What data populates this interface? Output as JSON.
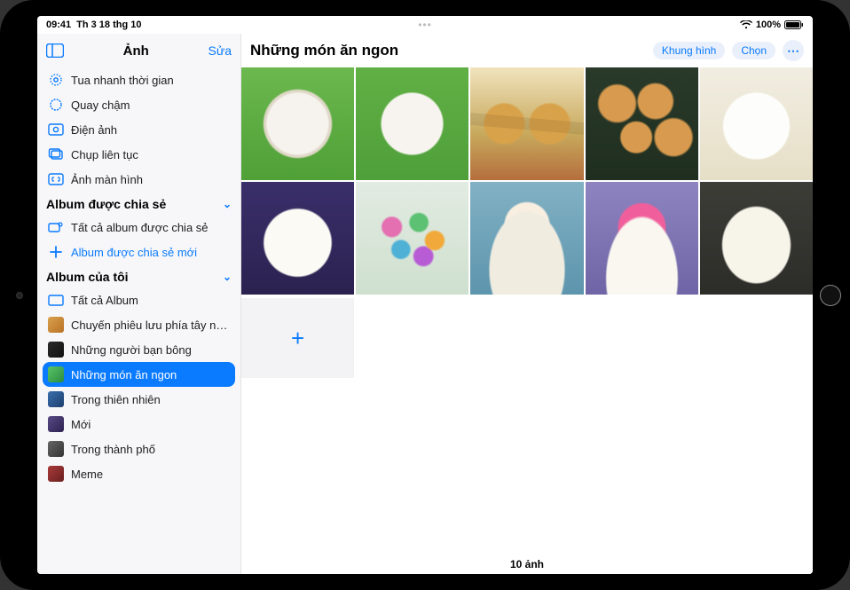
{
  "statusbar": {
    "time": "09:41",
    "date": "Th 3 18 thg 10",
    "battery": "100%"
  },
  "sidebar": {
    "title": "Ảnh",
    "edit": "Sửa",
    "media_types": {
      "items": [
        {
          "label": "Tua nhanh thời gian"
        },
        {
          "label": "Quay chậm"
        },
        {
          "label": "Điện ảnh"
        },
        {
          "label": "Chụp liên tục"
        },
        {
          "label": "Ảnh màn hình"
        }
      ]
    },
    "shared": {
      "title": "Album được chia sẻ",
      "items": [
        {
          "label": "Tất cả album được chia sẻ"
        },
        {
          "label": "Album được chia sẻ mới"
        }
      ]
    },
    "my_albums": {
      "title": "Album của tôi",
      "items": [
        {
          "label": "Tất cả Album"
        },
        {
          "label": "Chuyến phiêu lưu phía tây nam"
        },
        {
          "label": "Những người bạn bông"
        },
        {
          "label": "Những món ăn ngon"
        },
        {
          "label": "Trong thiên nhiên"
        },
        {
          "label": "Mới"
        },
        {
          "label": "Trong thành phố"
        },
        {
          "label": "Meme"
        }
      ]
    }
  },
  "main": {
    "title": "Những món ăn ngon",
    "actions": {
      "slideshow": "Khung hình",
      "select": "Chọn"
    },
    "count": "10 ảnh"
  }
}
